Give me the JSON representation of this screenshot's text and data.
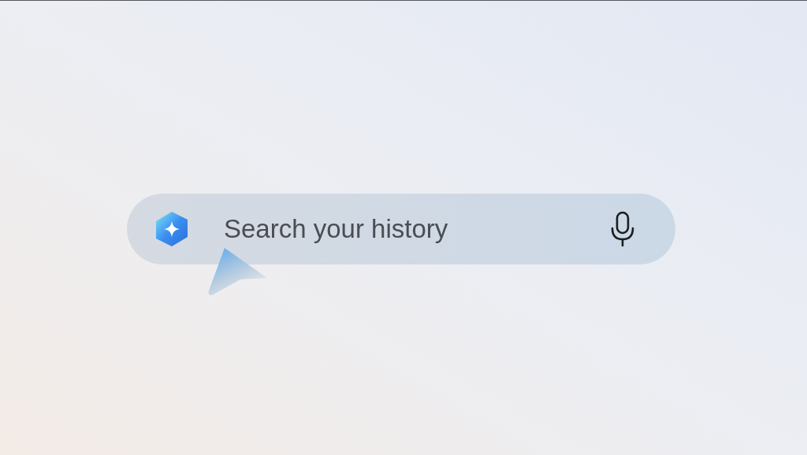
{
  "search": {
    "placeholder": "Search your history"
  }
}
